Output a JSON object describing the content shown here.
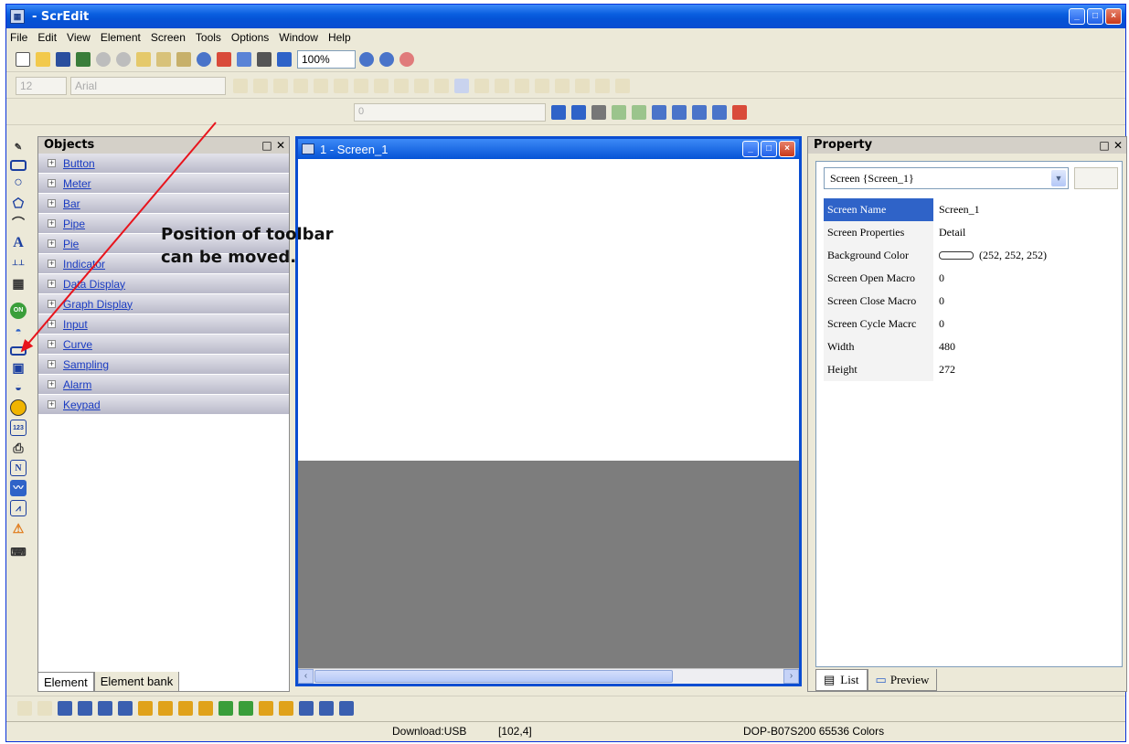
{
  "window": {
    "title": "- ScrEdit",
    "icon": "app-icon"
  },
  "menu": [
    "File",
    "Edit",
    "View",
    "Element",
    "Screen",
    "Tools",
    "Options",
    "Window",
    "Help"
  ],
  "toolbar": {
    "zoom_value": "100%",
    "font_size": "12",
    "font_name": "Arial",
    "dim_placeholder": "0"
  },
  "objects_panel": {
    "title": "Objects",
    "items": [
      "Button",
      "Meter",
      "Bar",
      "Pipe",
      "Pie",
      "Indicator",
      "Data Display",
      "Graph Display",
      "Input",
      "Curve",
      "Sampling",
      "Alarm",
      "Keypad"
    ],
    "tabs": [
      "Element",
      "Element bank"
    ]
  },
  "screen_window": {
    "title": "1 - Screen_1"
  },
  "property_panel": {
    "title": "Property",
    "selector": "Screen {Screen_1}",
    "rows": [
      {
        "key": "Screen Name",
        "value": "Screen_1"
      },
      {
        "key": "Screen Properties",
        "value": "Detail"
      },
      {
        "key": "Background Color",
        "value": "(252, 252, 252)"
      },
      {
        "key": "Screen Open Macro",
        "value": "0"
      },
      {
        "key": "Screen Close Macro",
        "value": "0"
      },
      {
        "key": "Screen Cycle Macrc",
        "value": "0"
      },
      {
        "key": "Width",
        "value": "480"
      },
      {
        "key": "Height",
        "value": "272"
      }
    ],
    "tabs": [
      "List",
      "Preview"
    ]
  },
  "status": {
    "download": "Download:USB",
    "coords": "[102,4]",
    "model": "DOP-B07S200 65536 Colors"
  },
  "annotation": {
    "line1": "Position of toolbar",
    "line2": "can be moved."
  },
  "colors": {
    "xp_blue": "#0a4dd1",
    "face": "#ece9d8",
    "selection": "#2f63c8",
    "arrow": "#e8141c"
  }
}
